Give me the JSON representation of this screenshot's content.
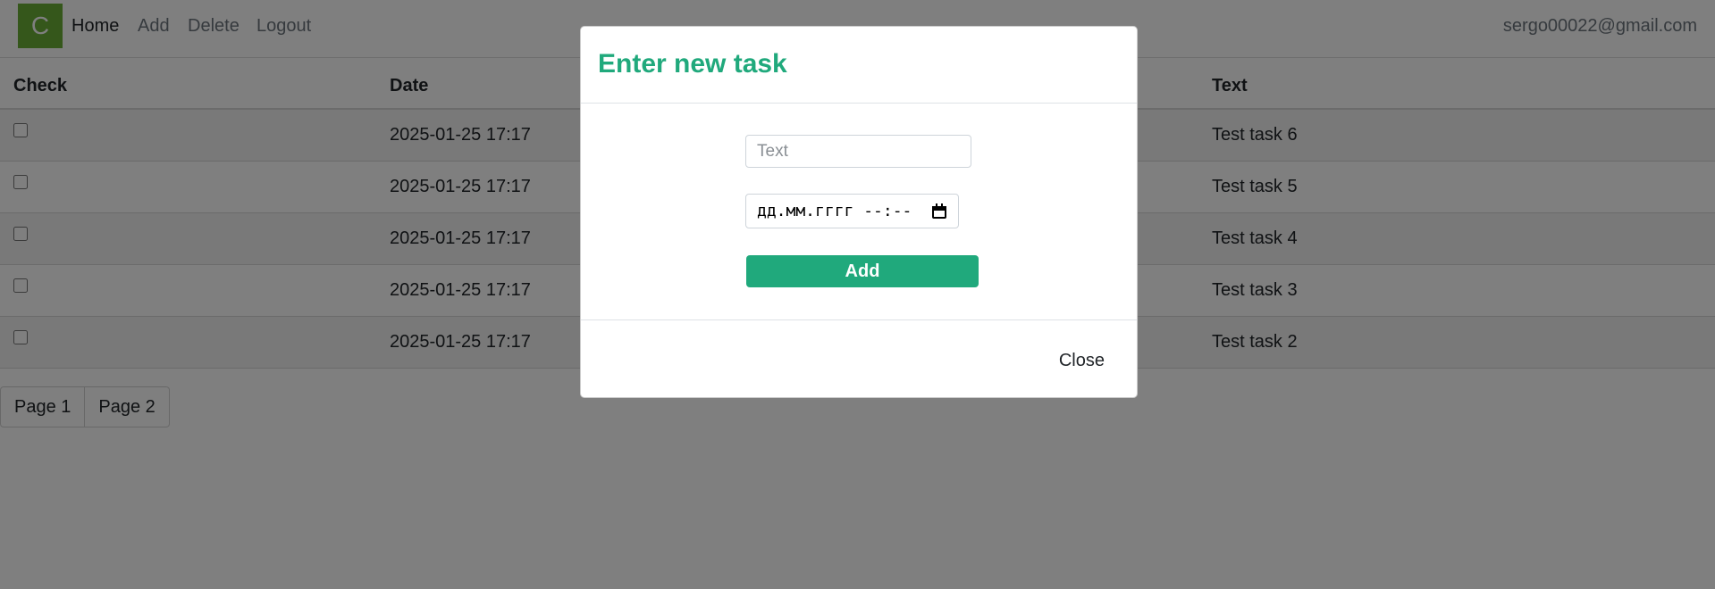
{
  "navbar": {
    "logo_letter": "C",
    "links": [
      "Home",
      "Add",
      "Delete",
      "Logout"
    ],
    "user_email": "sergo00022@gmail.com"
  },
  "table": {
    "headers": [
      "Check",
      "Date",
      "Text"
    ],
    "rows": [
      {
        "date": "2025-01-25 17:17",
        "text": "Test task 6"
      },
      {
        "date": "2025-01-25 17:17",
        "text": "Test task 5"
      },
      {
        "date": "2025-01-25 17:17",
        "text": "Test task 4"
      },
      {
        "date": "2025-01-25 17:17",
        "text": "Test task 3"
      },
      {
        "date": "2025-01-25 17:17",
        "text": "Test task 2"
      }
    ]
  },
  "pagination": [
    "Page 1",
    "Page 2"
  ],
  "modal": {
    "title": "Enter new task",
    "text_placeholder": "Text",
    "date_placeholder": "дд.мм.гггг --:--",
    "add_label": "Add",
    "close_label": "Close"
  },
  "colors": {
    "accent": "#20a97c",
    "logo": "#6aae37",
    "backdrop": "rgba(0,0,0,0.5)"
  },
  "icons": {
    "date_picker": "calendar-icon"
  }
}
